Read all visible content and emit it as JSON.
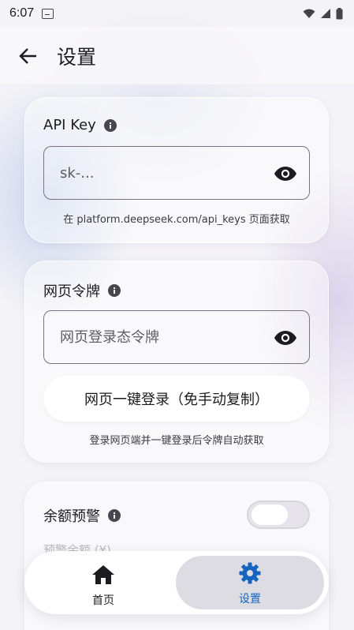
{
  "status_bar": {
    "time": "6:07"
  },
  "header": {
    "title": "设置"
  },
  "api_card": {
    "title": "API Key",
    "placeholder": "sk-...",
    "hint": "在 platform.deepseek.com/api_keys 页面获取"
  },
  "web_card": {
    "title": "网页令牌",
    "placeholder": "网页登录态令牌",
    "login_button": "网页一键登录（免手动复制）",
    "hint": "登录网页端并一键登录后令牌自动获取"
  },
  "balance_card": {
    "title": "余额预警",
    "toggle_on": false,
    "threshold_label": "预警余额 (¥)"
  },
  "bottom_nav": {
    "items": [
      {
        "label": "首页",
        "icon": "home-icon"
      },
      {
        "label": "设置",
        "icon": "gear-icon",
        "selected": true
      }
    ]
  },
  "colors": {
    "accent": "#1565c0",
    "selected_bg": "#dcdce2"
  }
}
